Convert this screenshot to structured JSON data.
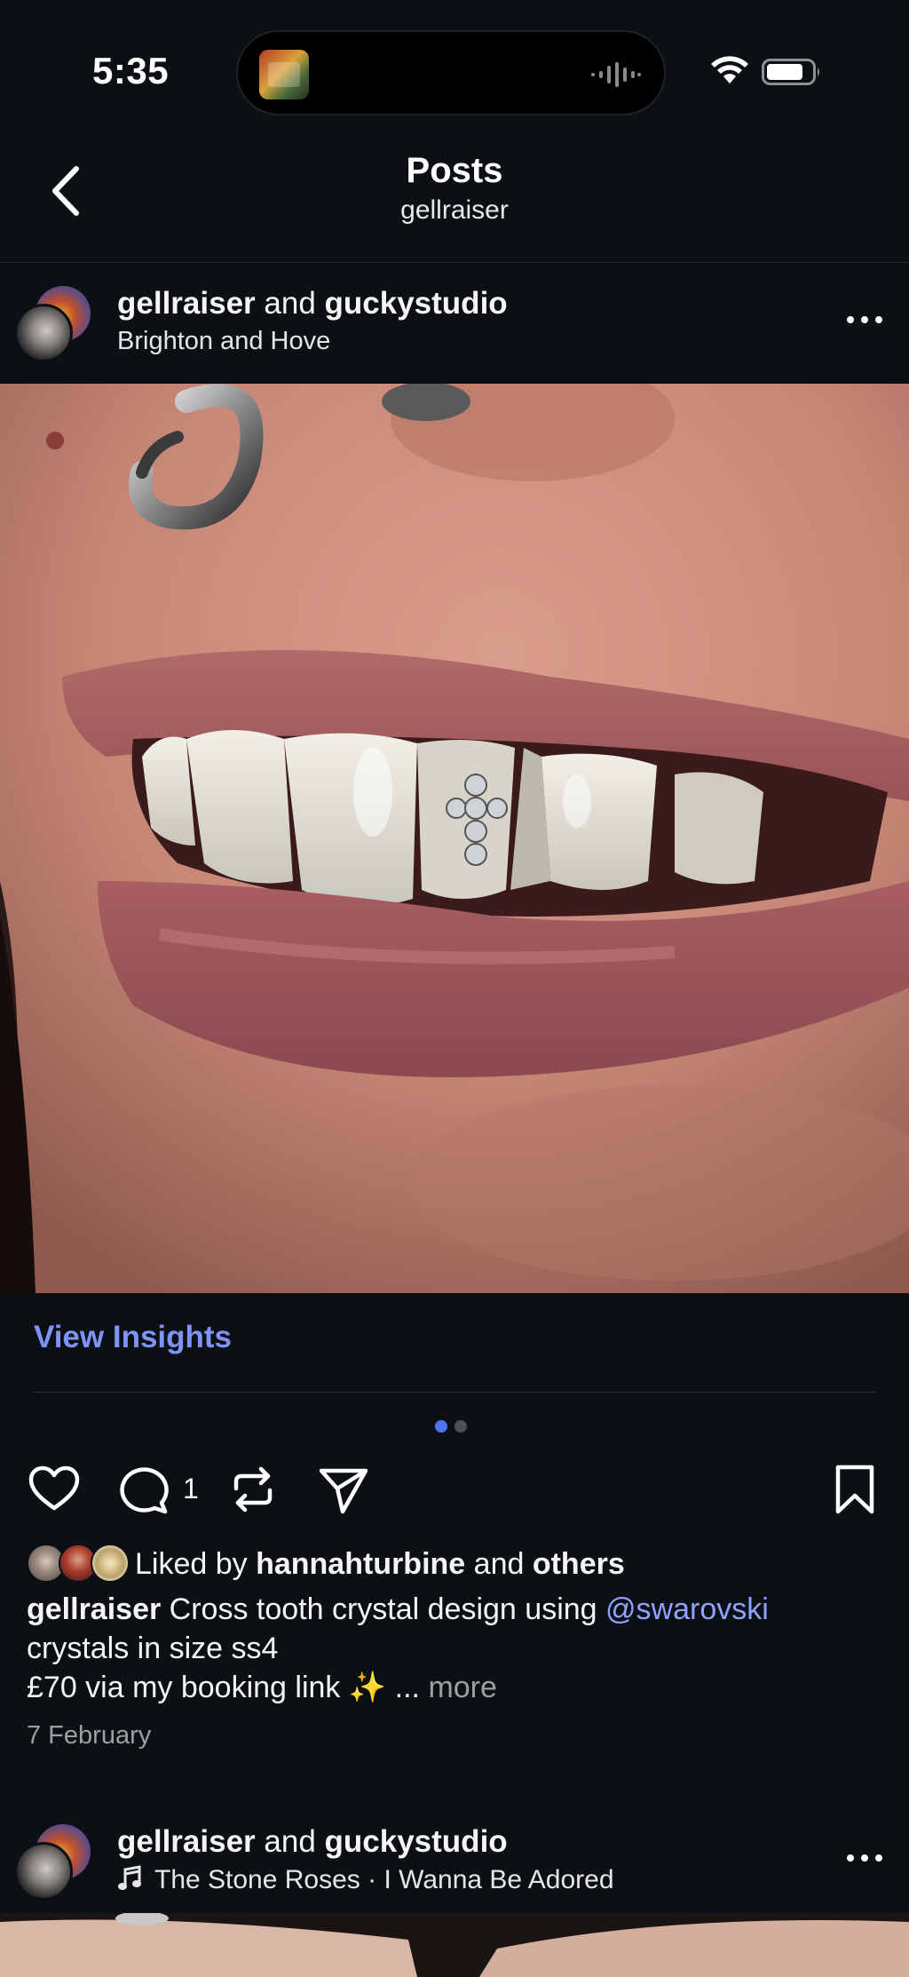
{
  "status_bar": {
    "time": "5:35",
    "icons": [
      "music-artwork-icon",
      "audio-wave-icon",
      "wifi-icon",
      "battery-icon"
    ]
  },
  "nav": {
    "title": "Posts",
    "subtitle": "gellraiser",
    "back_icon": "chevron-left-icon"
  },
  "post": {
    "author": "gellraiser",
    "connector": "and",
    "collaborator": "guckystudio",
    "location": "Brighton and Hove",
    "more_icon": "ellipsis-icon",
    "insights_label": "View Insights",
    "carousel": {
      "count": 2,
      "active_index": 0
    },
    "actions": {
      "like_icon": "heart-icon",
      "comment_icon": "comment-icon",
      "comment_count": "1",
      "repost_icon": "repost-icon",
      "share_icon": "send-icon",
      "save_icon": "bookmark-icon"
    },
    "likes": {
      "prefix": "Liked by",
      "user": "hannahturbine",
      "connector": "and",
      "others": "others"
    },
    "caption": {
      "author": "gellraiser",
      "text_before_mention": "Cross tooth crystal design using",
      "mention": "@swarovski",
      "line2": "crystals in size ss4",
      "line3": "£70 via my booking link ✨ ...",
      "more_label": "more"
    },
    "date": "7 February"
  },
  "next_post": {
    "author": "gellraiser",
    "connector": "and",
    "collaborator": "guckystudio",
    "song": "The Stone Roses · I Wanna Be Adored",
    "more_icon": "ellipsis-icon",
    "music_icon": "music-note-icon"
  },
  "colors": {
    "background": "#0c1014",
    "link_blue": "#7f93f6",
    "mention_blue": "#8fa2ff",
    "carousel_active": "#4e74f0",
    "muted_text": "#9aa0a6"
  }
}
